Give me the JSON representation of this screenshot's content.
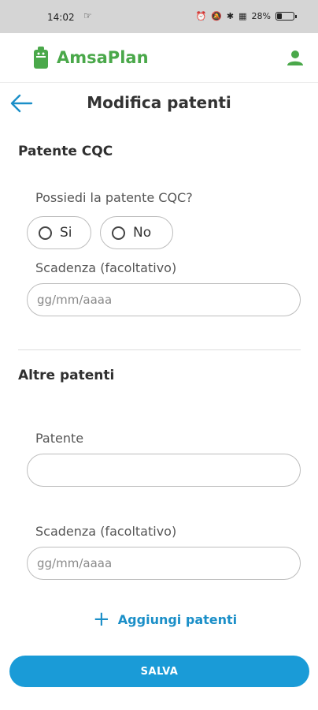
{
  "status_bar": {
    "time": "14:02",
    "battery_text": "28%",
    "battery_level_percent": 28
  },
  "app": {
    "brand": "AmsaPlan",
    "colors": {
      "brand_green": "#4aa84a",
      "accent_blue": "#1a9bd7"
    }
  },
  "header": {
    "title": "Modifica patenti"
  },
  "cqc_section": {
    "title": "Patente CQC",
    "question": "Possiedi la patente CQC?",
    "options": [
      "Si",
      "No"
    ],
    "expiry_label": "Scadenza (facoltativo)",
    "expiry_placeholder": "gg/mm/aaaa"
  },
  "other_section": {
    "title": "Altre patenti",
    "license_label": "Patente",
    "license_value": "",
    "expiry_label": "Scadenza (facoltativo)",
    "expiry_placeholder": "gg/mm/aaaa",
    "add_label": "Aggiungi patenti"
  },
  "save_label": "SALVA"
}
